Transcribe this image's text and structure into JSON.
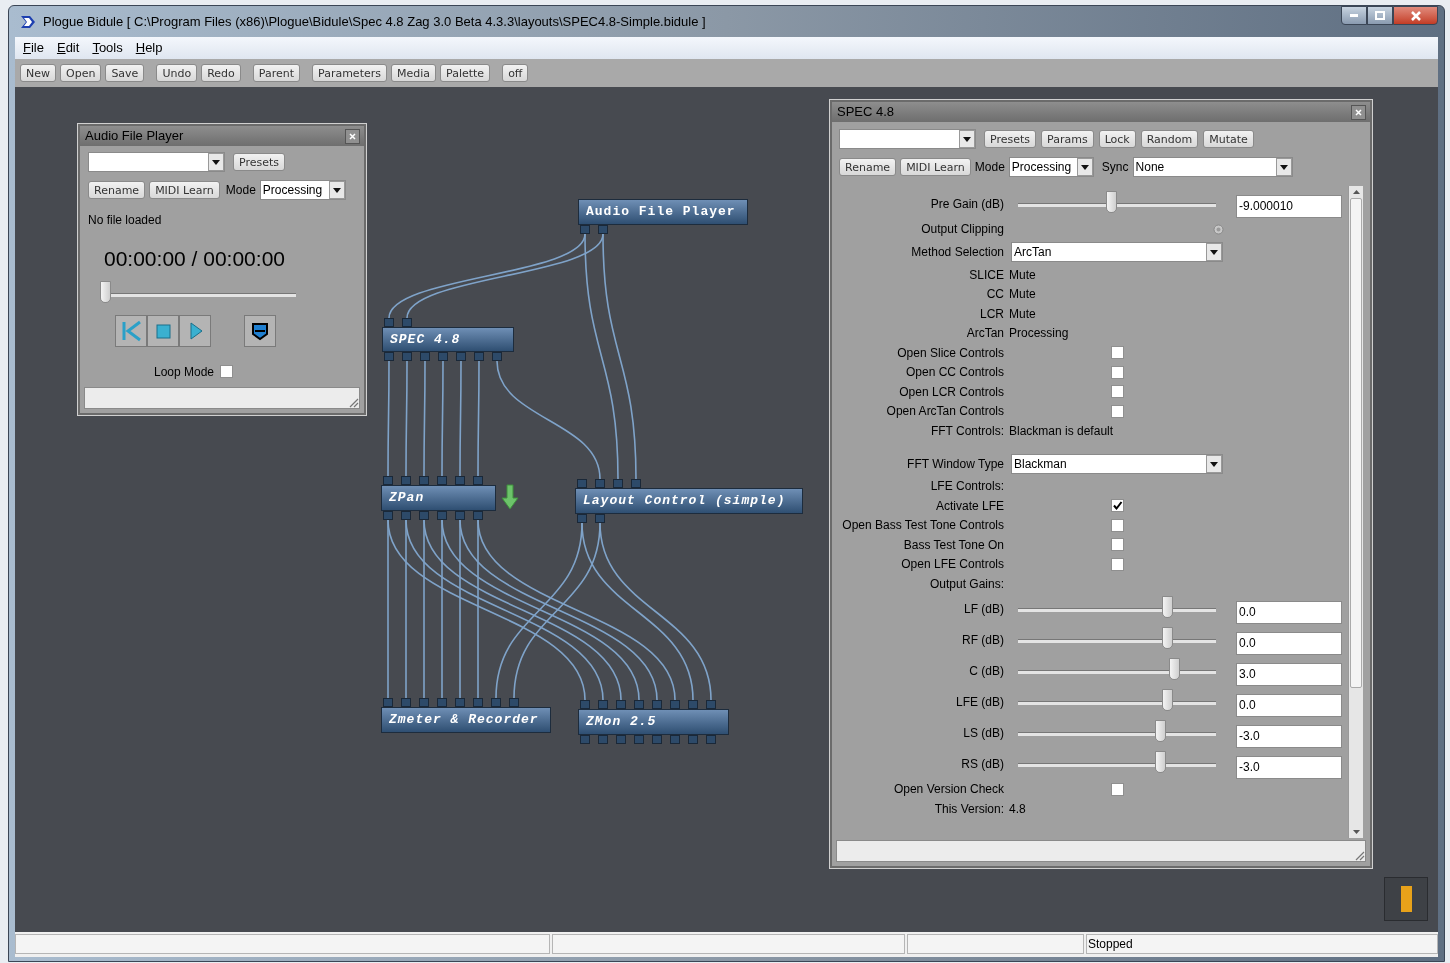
{
  "window": {
    "title": "Plogue Bidule [ C:\\Program Files (x86)\\Plogue\\Bidule\\Spec 4.8 Zag 3.0 Beta 4.3.3\\layouts\\SPEC4.8-Simple.bidule ]"
  },
  "menu": [
    "File",
    "Edit",
    "Tools",
    "Help"
  ],
  "toolbar_groups": [
    [
      "New",
      "Open",
      "Save"
    ],
    [
      "Undo",
      "Redo"
    ],
    [
      "Parent"
    ],
    [
      "Parameters",
      "Media",
      "Palette"
    ],
    [
      "off"
    ]
  ],
  "audio_file_player": {
    "title": "Audio File Player",
    "presets_button": "Presets",
    "buttons": [
      "Rename",
      "MIDI Learn"
    ],
    "mode_label": "Mode",
    "mode_value": "Processing",
    "file_status": "No file loaded",
    "time": "00:00:00 / 00:00:00",
    "position": {
      "level": 0
    },
    "loop": {
      "label": "Loop Mode",
      "checked": false
    }
  },
  "nodes": [
    {
      "label": "Audio File Player"
    },
    {
      "label": "SPEC 4.8"
    },
    {
      "label": "ZPan"
    },
    {
      "label": "Layout Control (simple)"
    },
    {
      "label": "Zmeter & Recorder"
    },
    {
      "label": "ZMon 2.5"
    }
  ],
  "spec_panel": {
    "title": "SPEC 4.8",
    "top_buttons": [
      "Presets",
      "Params",
      "Lock",
      "Random",
      "Mutate"
    ],
    "buttons": [
      "Rename",
      "MIDI Learn"
    ],
    "mode_label": "Mode",
    "mode_value": "Processing",
    "sync_label": "Sync",
    "sync_value": "None",
    "rows": [
      {
        "kind": "slider",
        "label": "Pre Gain (dB)",
        "level": 0.47,
        "value": "-9.000010"
      },
      {
        "kind": "led",
        "label": "Output Clipping"
      },
      {
        "kind": "select",
        "label": "Method Selection",
        "value": "ArcTan"
      },
      {
        "kind": "text",
        "label": "SLICE",
        "value": "Mute"
      },
      {
        "kind": "text",
        "label": "CC",
        "value": "Mute"
      },
      {
        "kind": "text",
        "label": "LCR",
        "value": "Mute"
      },
      {
        "kind": "text",
        "label": "ArcTan",
        "value": "Processing"
      },
      {
        "kind": "checkbox",
        "label": "Open Slice Controls",
        "checked": false
      },
      {
        "kind": "checkbox",
        "label": "Open CC Controls",
        "checked": false
      },
      {
        "kind": "checkbox",
        "label": "Open LCR Controls",
        "checked": false
      },
      {
        "kind": "checkbox",
        "label": "Open ArcTan Controls",
        "checked": false
      },
      {
        "kind": "text",
        "label": "FFT Controls:",
        "value": "Blackman is default"
      },
      {
        "kind": "select",
        "label": "FFT Window Type",
        "value": "Blackman"
      },
      {
        "kind": "heading",
        "label": "LFE Controls:"
      },
      {
        "kind": "checkbox",
        "label": "Activate LFE",
        "checked": true
      },
      {
        "kind": "checkbox",
        "label": "Open Bass Test Tone Controls",
        "checked": false
      },
      {
        "kind": "checkbox",
        "label": "Bass Test Tone On",
        "checked": false
      },
      {
        "kind": "checkbox",
        "label": "Open LFE Controls",
        "checked": false
      },
      {
        "kind": "heading",
        "label": "Output Gains:"
      },
      {
        "kind": "slider",
        "label": "LF (dB)",
        "level": 0.77,
        "value": "0.0"
      },
      {
        "kind": "slider",
        "label": "RF (dB)",
        "level": 0.77,
        "value": "0.0"
      },
      {
        "kind": "slider",
        "label": "C (dB)",
        "level": 0.81,
        "value": "3.0"
      },
      {
        "kind": "slider",
        "label": "LFE (dB)",
        "level": 0.77,
        "value": "0.0"
      },
      {
        "kind": "slider",
        "label": "LS (dB)",
        "level": 0.73,
        "value": "-3.0"
      },
      {
        "kind": "slider",
        "label": "RS (dB)",
        "level": 0.73,
        "value": "-3.0"
      },
      {
        "kind": "checkbox",
        "label": "Open Version Check",
        "checked": false
      },
      {
        "kind": "text",
        "label": "This Version:",
        "value": "4.8"
      }
    ]
  },
  "status_bar": {
    "text": "Stopped"
  }
}
